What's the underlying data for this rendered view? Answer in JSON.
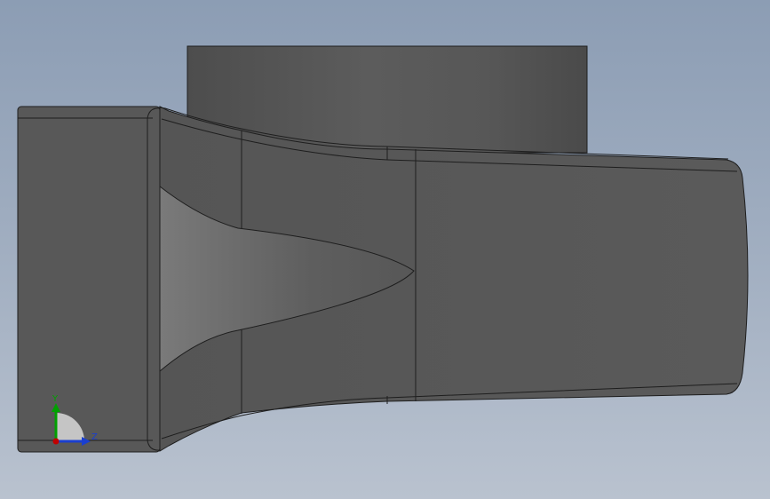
{
  "colors": {
    "background_top": "#8c9db4",
    "background_bottom": "#b9c2cf",
    "model_face": "#575757",
    "model_edge": "#1e1e1e",
    "axis_x": "#c00000",
    "axis_y": "#00a000",
    "axis_z": "#1a3fd0"
  },
  "triad": {
    "y_label": "Y",
    "z_label": "Z"
  },
  "icons": [
    "coordinate-triad-icon"
  ]
}
